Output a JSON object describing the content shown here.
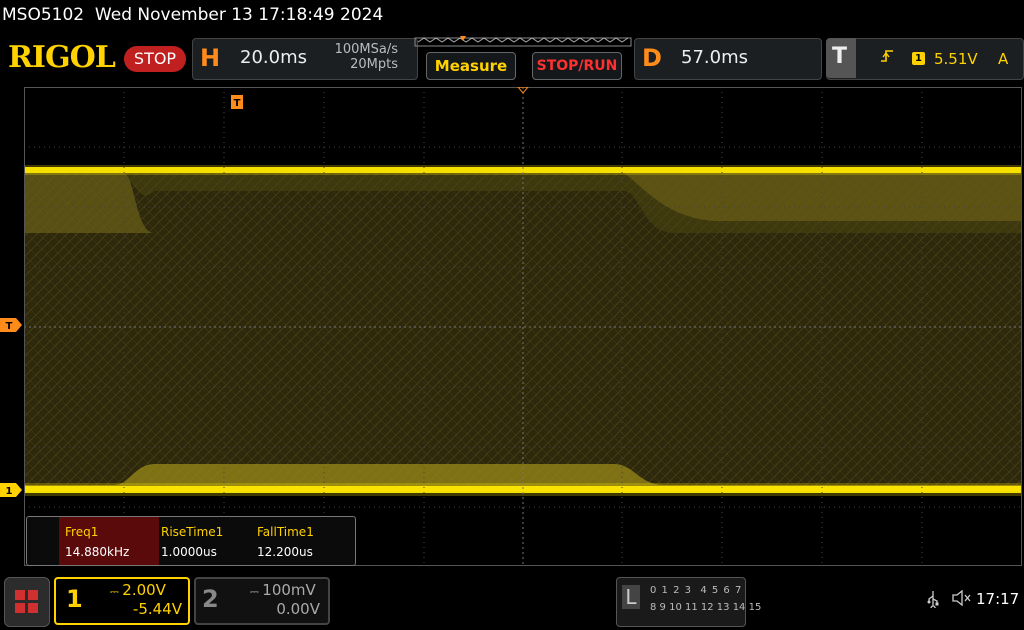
{
  "title_bar": {
    "model": "MSO5102",
    "datetime": "Wed November 13 17:18:49 2024"
  },
  "toolbar": {
    "brand": "RIGOL",
    "run_state": "STOP",
    "horizontal": {
      "letter": "H",
      "timebase": "20.0ms",
      "sample_rate": "100MSa/s",
      "memory_depth": "20Mpts"
    },
    "measure_label": "Measure",
    "stop_run_label": "STOP/RUN",
    "delay": {
      "letter": "D",
      "value": "57.0ms"
    },
    "trigger": {
      "letter": "T",
      "edge_icon": "rising-edge-icon",
      "source": "1",
      "level": "5.51V",
      "mode": "A"
    }
  },
  "screen": {
    "trigger_marker_left": "T",
    "channel_marker_left": "1",
    "trigger_position_marker": "T",
    "trace_color": "#ffe800"
  },
  "measurements": {
    "items": [
      {
        "name": "Freq1",
        "value": "14.880kHz"
      },
      {
        "name": "RiseTime1",
        "value": "1.0000us"
      },
      {
        "name": "FallTime1",
        "value": "12.200us"
      }
    ]
  },
  "bottom_bar": {
    "ch1": {
      "number": "1",
      "scale": "2.00V",
      "offset": "-5.44V",
      "color": "#ffd200"
    },
    "ch2": {
      "number": "2",
      "scale": "100mV",
      "offset": "0.00V"
    },
    "logic": {
      "letter": "L",
      "row1": "0 1 2 3  4 5 6 7",
      "row2": "8 9 10 11 12 13 14 15"
    },
    "usb_icon": "usb-icon",
    "sound_icon": "speaker-muted-icon",
    "time": "17:17"
  }
}
